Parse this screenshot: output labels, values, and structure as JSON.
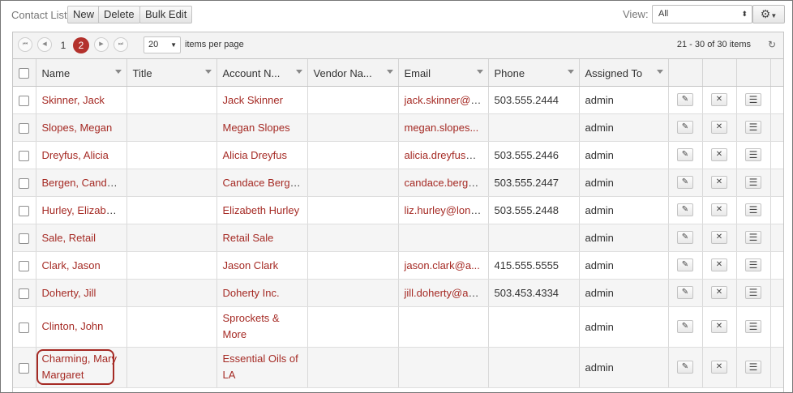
{
  "toolbar": {
    "title": "Contact List",
    "new_label": "New",
    "delete_label": "Delete",
    "bulk_edit_label": "Bulk Edit",
    "view_label": "View:",
    "view_value": "All"
  },
  "pager": {
    "pages": [
      "1",
      "2"
    ],
    "current_page": "2",
    "page_size": "20",
    "items_per_page_label": "items per page",
    "info": "21 - 30 of 30 items"
  },
  "columns": [
    "Name",
    "Title",
    "Account N...",
    "Vendor Na...",
    "Email",
    "Phone",
    "Assigned To"
  ],
  "rows": [
    {
      "name": "Skinner, Jack",
      "title": "",
      "account": "Jack Skinner",
      "vendor": "",
      "email": "jack.skinner@y...",
      "phone": "503.555.2444",
      "assigned": "admin"
    },
    {
      "name": "Slopes, Megan",
      "title": "",
      "account": "Megan Slopes",
      "vendor": "",
      "email": "megan.slopes...",
      "phone": "",
      "assigned": "admin"
    },
    {
      "name": "Dreyfus, Alicia",
      "title": "",
      "account": "Alicia Dreyfus",
      "vendor": "",
      "email": "alicia.dreyfus@...",
      "phone": "503.555.2446",
      "assigned": "admin"
    },
    {
      "name": "Bergen, Candace",
      "title": "",
      "account": "Candace Bergen",
      "vendor": "",
      "email": "candace.berge...",
      "phone": "503.555.2447",
      "assigned": "admin"
    },
    {
      "name": "Hurley, Elizabeth",
      "title": "",
      "account": "Elizabeth Hurley",
      "vendor": "",
      "email": "liz.hurley@lond...",
      "phone": "503.555.2448",
      "assigned": "admin"
    },
    {
      "name": "Sale, Retail",
      "title": "",
      "account": "Retail Sale",
      "vendor": "",
      "email": "",
      "phone": "",
      "assigned": "admin"
    },
    {
      "name": "Clark, Jason",
      "title": "",
      "account": "Jason Clark",
      "vendor": "",
      "email": "jason.clark@a...",
      "phone": "415.555.5555",
      "assigned": "admin"
    },
    {
      "name": "Doherty, Jill",
      "title": "",
      "account": "Doherty Inc.",
      "vendor": "",
      "email": "jill.doherty@agi...",
      "phone": "503.453.4334",
      "assigned": "admin"
    },
    {
      "name": "Clinton, John",
      "title": "",
      "account": "Sprockets & More",
      "vendor": "",
      "email": "",
      "phone": "",
      "assigned": "admin"
    },
    {
      "name": "Charming, Mary Margaret",
      "title": "",
      "account": "Essential Oils of LA",
      "vendor": "",
      "email": "",
      "phone": "",
      "assigned": "admin"
    }
  ],
  "icons": {
    "edit": "pencil-icon",
    "delete": "x-icon",
    "menu": "hamburger-icon",
    "settings": "gear-icon",
    "refresh": "refresh-icon"
  },
  "colors": {
    "link": "#a52a24",
    "active_page": "#b3312c",
    "highlight": "#a52a24"
  }
}
